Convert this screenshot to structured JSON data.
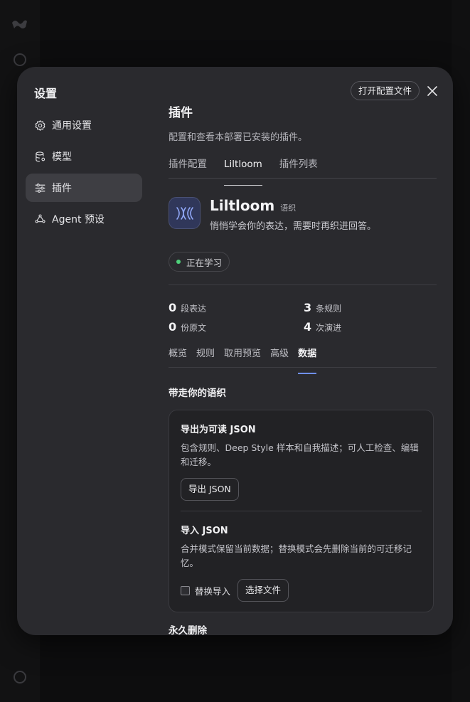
{
  "modal": {
    "title": "设置",
    "open_config_label": "打开配置文件"
  },
  "sidebar": {
    "items": [
      {
        "label": "通用设置",
        "icon": "gear-icon"
      },
      {
        "label": "模型",
        "icon": "database-icon"
      },
      {
        "label": "插件",
        "icon": "sliders-icon",
        "active": true
      },
      {
        "label": "Agent 预设",
        "icon": "agent-icon"
      }
    ]
  },
  "section": {
    "title": "插件",
    "description": "配置和查看本部署已安装的插件。",
    "tabs": [
      "插件配置",
      "Liltloom",
      "插件列表"
    ],
    "active_tab": "Liltloom"
  },
  "plugin": {
    "name": "Liltloom",
    "tag": "语织",
    "tagline": "悄悄学会你的表达，需要时再织进回答。",
    "status": "正在学习",
    "status_color": "#4fd17a",
    "accent_color": "#6f8ff0",
    "stats": [
      {
        "value": "0",
        "label": "段表达"
      },
      {
        "value": "3",
        "label": "条规则"
      },
      {
        "value": "0",
        "label": "份原文"
      },
      {
        "value": "4",
        "label": "次演进"
      }
    ],
    "subtabs": [
      "概览",
      "规则",
      "取用预览",
      "高级",
      "数据"
    ],
    "active_subtab": "数据"
  },
  "data_panel": {
    "group_title": "带走你的语织",
    "export": {
      "title": "导出为可读 JSON",
      "description": "包含规则、Deep Style 样本和自我描述；可人工检查、编辑和迁移。",
      "button": "导出 JSON"
    },
    "import": {
      "title": "导入 JSON",
      "description": "合并模式保留当前数据；替换模式会先删除当前的可迁移记忆。",
      "replace_label": "替换导入",
      "replace_checked": false,
      "choose_file_button": "选择文件"
    },
    "danger_title": "永久删除"
  }
}
